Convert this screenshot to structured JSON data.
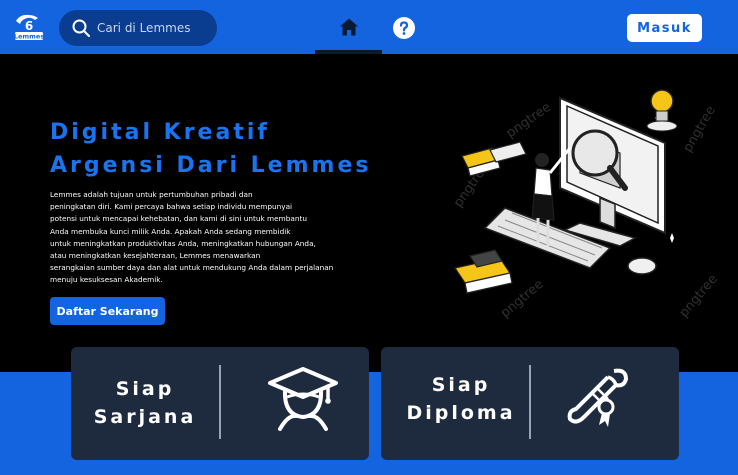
{
  "navbar": {
    "logo_text": "Lemmes",
    "search_placeholder": "Cari di Lemmes",
    "login_label": "Masuk"
  },
  "hero": {
    "title_lines": [
      "Digital Kreatif",
      "Argensi Dari Lemmes"
    ],
    "description_lines": [
      "Lemmes adalah tujuan untuk pertumbuhan pribadi dan",
      "peningkatan diri. Kami percaya bahwa setiap individu mempunyai",
      "potensi untuk mencapai kehebatan, dan kami di sini untuk membantu",
      "Anda membuka kunci milik Anda. Apakah Anda sedang membidik",
      "untuk meningkatkan produktivitas Anda, meningkatkan hubungan Anda,",
      "atau meningkatkan kesejahteraan, Lemmes menawarkan",
      "serangkaian sumber daya dan alat untuk mendukung Anda dalam perjalanan",
      "menuju kesuksesan Akademik."
    ],
    "cta_label": "Daftar Sekarang",
    "watermark": "pngtree"
  },
  "cards": [
    {
      "title_lines": [
        "Siap",
        "Sarjana"
      ],
      "icon": "graduate-icon"
    },
    {
      "title_lines": [
        "Siap",
        "Diploma"
      ],
      "icon": "diploma-scroll-icon"
    }
  ],
  "colors": {
    "primary": "#1464e0",
    "title_blue": "#1a74f0",
    "card_bg": "#1e2b3f",
    "search_bg": "#0a3d8f"
  }
}
